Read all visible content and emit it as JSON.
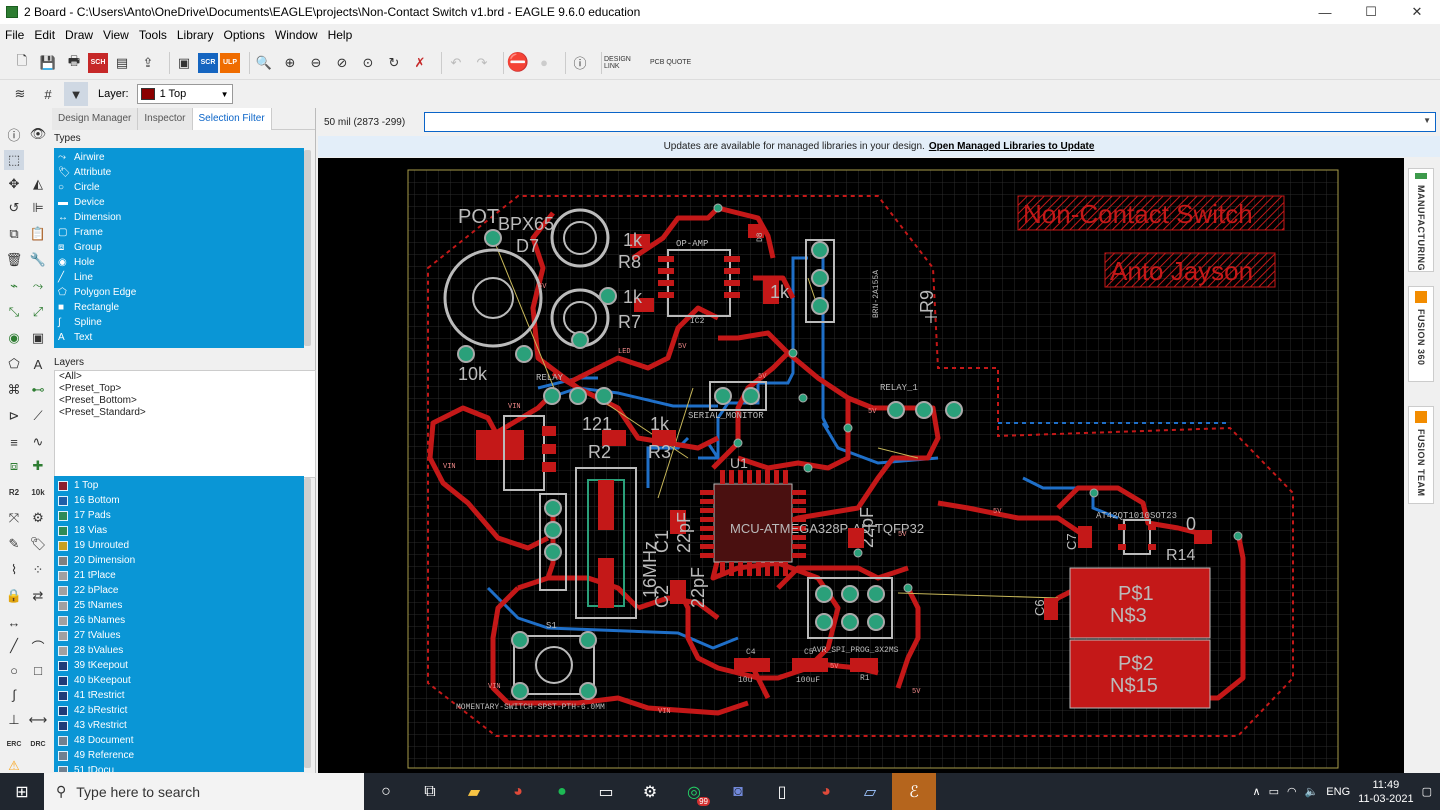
{
  "window": {
    "title": "2 Board - C:\\Users\\Anto\\OneDrive\\Documents\\EAGLE\\projects\\Non-Contact Switch v1.brd - EAGLE 9.6.0 education",
    "min": "—",
    "max": "☐",
    "close": "✕"
  },
  "menu": [
    "File",
    "Edit",
    "Draw",
    "View",
    "Tools",
    "Library",
    "Options",
    "Window",
    "Help"
  ],
  "toolbar": {
    "sch": "SCH",
    "scr": "SCR",
    "ulp": "ULP",
    "design_link": "DESIGN LINK",
    "pcb_quote": "PCB QUOTE"
  },
  "layerbar": {
    "label": "Layer:",
    "value": "1 Top",
    "color": "#8b0000"
  },
  "panel": {
    "tabs": [
      "Design Manager",
      "Inspector",
      "Selection Filter"
    ],
    "types_title": "Types",
    "types": [
      "Airwire",
      "Attribute",
      "Circle",
      "Device",
      "Dimension",
      "Frame",
      "Group",
      "Hole",
      "Line",
      "Polygon Edge",
      "Rectangle",
      "Spline",
      "Text"
    ],
    "layers_title": "Layers",
    "presets": [
      "<All>",
      "<Preset_Top>",
      "<Preset_Bottom>",
      "<Preset_Standard>"
    ],
    "layer_list": [
      "1 Top",
      "16 Bottom",
      "17 Pads",
      "18 Vias",
      "19 Unrouted",
      "20 Dimension",
      "21 tPlace",
      "22 bPlace",
      "25 tNames",
      "26 bNames",
      "27 tValues",
      "28 bValues",
      "39 tKeepout",
      "40 bKeepout",
      "41 tRestrict",
      "42 bRestrict",
      "43 vRestrict",
      "48 Document",
      "49 Reference",
      "51 tDocu"
    ],
    "layer_colors": [
      "#8b2030",
      "#1f5fa8",
      "#2e8b57",
      "#2e8b57",
      "#c8a020",
      "#808080",
      "#a0a0a0",
      "#a0a0a0",
      "#a0a0a0",
      "#a0a0a0",
      "#a0a0a0",
      "#a0a0a0",
      "#203c78",
      "#203c78",
      "#203c78",
      "#203c78",
      "#203c78",
      "#708090",
      "#708090",
      "#708090"
    ]
  },
  "coords": "50 mil (2873 -299)",
  "notice": {
    "text": "Updates are available for managed libraries in your design.",
    "link": "Open Managed Libraries to Update"
  },
  "board": {
    "title1": "Non-Contact Switch",
    "title2": "Anto Jayson",
    "labels": {
      "pot": "POT",
      "bpx": "BPX65",
      "d7": "D7",
      "r8": "R8",
      "k1a": "1k",
      "k1b": "1k",
      "r7": "R7",
      "opamp": "OP-AMP",
      "ic2": "IC2",
      "d8": "D8",
      "r9": "R9",
      "relay": "RELAY",
      "relay1": "RELAY_1",
      "serial": "SERIAL_MONITOR",
      "r2": "R2",
      "r3": "R3",
      "k10": "10k",
      "r121": "121",
      "k1c": "1k",
      "u1": "U1",
      "mcu": "MCU-ATMEGA328P-AU-TQFP32",
      "c1": "C1",
      "c2": "C2",
      "pf1": "22pF",
      "pf2": "22pF",
      "pf3": "22pF",
      "mhz": "16MHz",
      "s1": "S1",
      "avr": "AVR_SPI_PROG_3X2MS",
      "at42": "AT42QT1010SOT23",
      "r14": "R14",
      "zero": "0",
      "c7": "C7",
      "c6": "C6",
      "ps1": "P$1",
      "ns3": "N$3",
      "ps2": "P$2",
      "ns15": "N$15",
      "c4": "C4",
      "c5": "C5",
      "r1": "R1",
      "u10": "10u",
      "u100": "100uF",
      "mom": "MOMENTARY-SWITCH-SPST-PTH-6.0MM",
      "vin": "VIN",
      "v5": "5V",
      "brn": "BRN-2A155A",
      "led": "LED"
    }
  },
  "sidetabs": [
    "MANUFACTURING",
    "FUSION 360",
    "FUSION TEAM"
  ],
  "taskbar": {
    "search_placeholder": "Type here to search",
    "lang": "ENG",
    "time": "11:49",
    "date": "11-03-2021",
    "badge": "99"
  }
}
